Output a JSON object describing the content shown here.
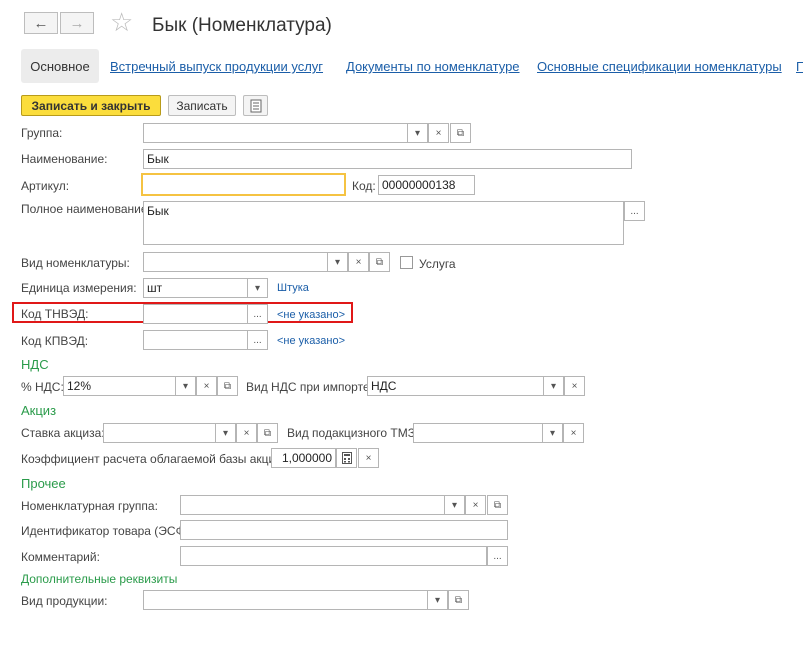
{
  "window": {
    "title": "Бык (Номенклатура)"
  },
  "nav": {
    "back": "←",
    "forward": "→"
  },
  "tabs": [
    {
      "label": "Основное"
    },
    {
      "label": "Встречный выпуск продукции услуг"
    },
    {
      "label": "Документы по номенклатуре"
    },
    {
      "label": "Основные спецификации номенклатуры"
    },
    {
      "label": "П"
    }
  ],
  "toolbar": {
    "save_close": "Записать и закрыть",
    "save": "Записать"
  },
  "fields": {
    "group": {
      "label": "Группа:",
      "value": ""
    },
    "name": {
      "label": "Наименование:",
      "value": "Бык"
    },
    "article": {
      "label": "Артикул:",
      "value": ""
    },
    "code": {
      "label": "Код:",
      "value": "00000000138"
    },
    "full_name": {
      "label": "Полное наименование:",
      "value": "Бык"
    },
    "kind": {
      "label": "Вид номенклатуры:",
      "value": ""
    },
    "service": {
      "label": "Услуга"
    },
    "unit": {
      "label": "Единица измерения:",
      "value": "шт",
      "link": "Штука"
    },
    "tnved": {
      "label": "Код ТНВЭД:",
      "value": "",
      "link": "<не указано>"
    },
    "kpved": {
      "label": "Код КПВЭД:",
      "value": "",
      "link": "<не указано>"
    }
  },
  "vat": {
    "section": "НДС",
    "rate_label": "% НДС:",
    "rate_value": "12%",
    "import_label": "Вид НДС при импорте:",
    "import_value": "НДС"
  },
  "excise": {
    "section": "Акциз",
    "rate_label": "Ставка акциза:",
    "rate_value": "",
    "kind_label": "Вид подакцизного ТМЗ:",
    "kind_value": "",
    "coef_label": "Коэффициент расчета облагаемой базы акциза:",
    "coef_value": "1,000000"
  },
  "other": {
    "section": "Прочее",
    "group_label": "Номенклатурная группа:",
    "group_value": "",
    "id_label": "Идентификатор товара (ЭСФ):",
    "id_value": "",
    "comment_label": "Комментарий:",
    "comment_value": ""
  },
  "extra": {
    "section": "Дополнительные реквизиты",
    "product_label": "Вид продукции:",
    "product_value": ""
  },
  "icons": {
    "dropdown": "▾",
    "clear": "×",
    "open": "⧉",
    "dots": "...",
    "star": "☆"
  },
  "colors": {
    "accent": "#fbdd3c",
    "link": "#1b5ea8",
    "section": "#2a9b4a",
    "highlight": "#e01818"
  }
}
